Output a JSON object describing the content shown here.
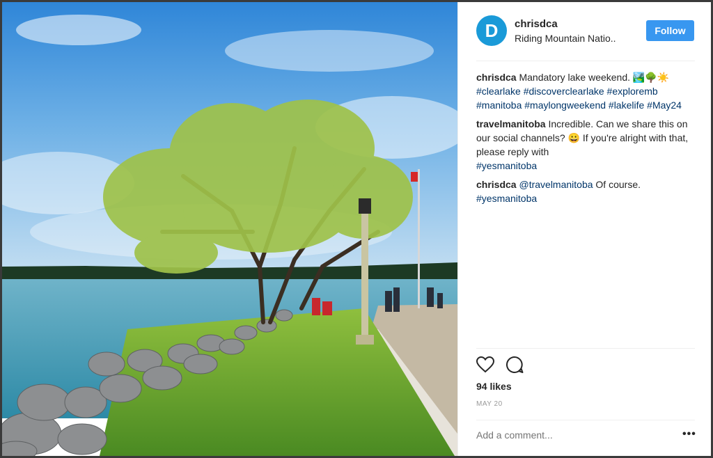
{
  "post": {
    "avatar_letter": "D",
    "username": "chrisdca",
    "location": "Riding Mountain Natio..",
    "follow_label": "Follow",
    "likes": "94 likes",
    "date": "MAY 20",
    "add_comment_placeholder": "Add a comment...",
    "more_options": "•••"
  },
  "comments": [
    {
      "user": "chrisdca",
      "text": "Mandatory lake weekend. 🏞️🌳☀️",
      "hashtags": "#clearlake #discoverclearlake #exploremb #manitoba #maylongweekend #lakelife #May24"
    },
    {
      "user": "travelmanitoba",
      "text": "Incredible. Can we share this on our social channels? 😀 If you're alright with that, please reply with",
      "hashtags": "#yesmanitoba"
    },
    {
      "user": "chrisdca",
      "mention": "@travelmanitoba",
      "text": "Of course.",
      "hashtags": "#yesmanitoba"
    }
  ],
  "icons": {
    "like": "heart-icon",
    "comment": "comment-bubble-icon",
    "more": "more-dots-icon"
  },
  "colors": {
    "follow_button": "#3897f0",
    "avatar": "#1a9ad8",
    "hashtag": "#003569",
    "text": "#262626",
    "muted": "#999999"
  }
}
